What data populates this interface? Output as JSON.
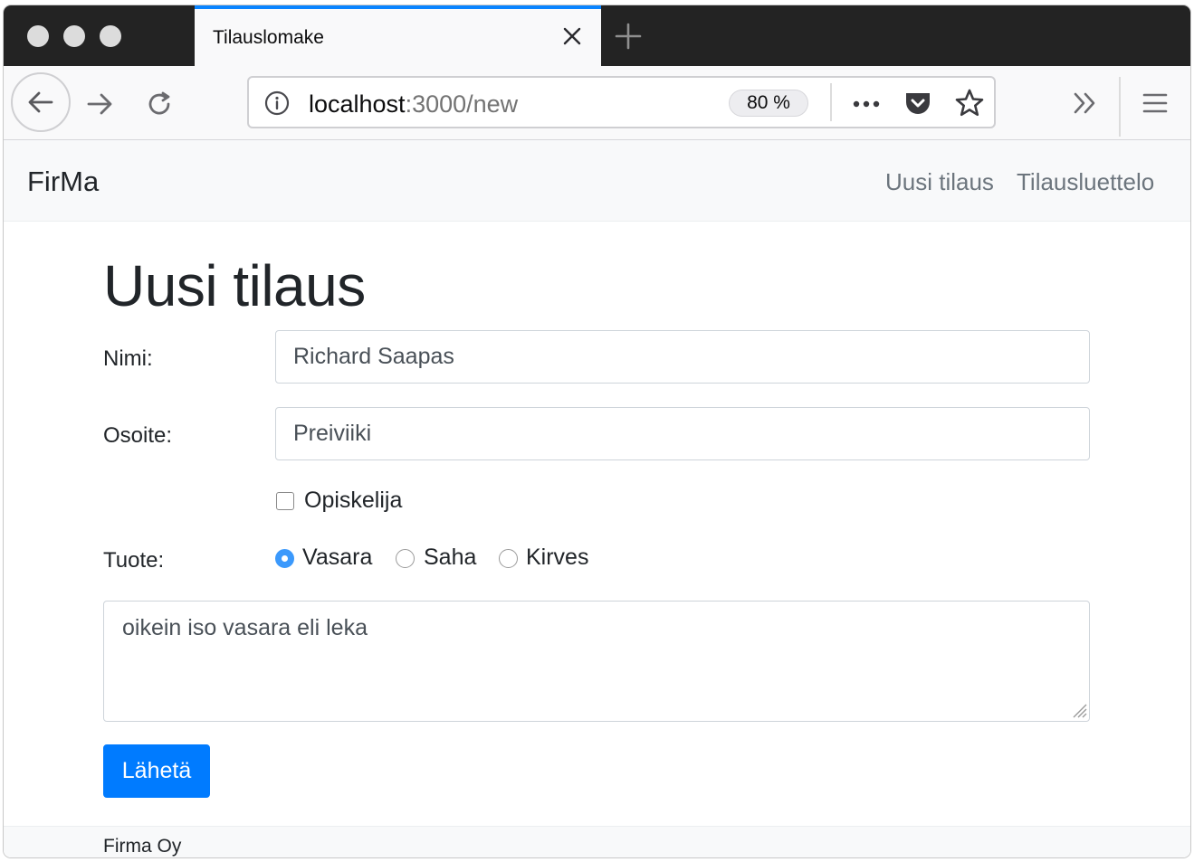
{
  "browser": {
    "tab_title": "Tilauslomake",
    "url_host": "localhost",
    "url_path": ":3000/new",
    "zoom": "80 %",
    "accent_color": "#0a84ff",
    "icons": [
      "back-arrow-icon",
      "forward-arrow-icon",
      "reload-icon",
      "info-icon",
      "more-icon",
      "pocket-icon",
      "bookmark-star-icon",
      "overflow-chevrons-icon",
      "hamburger-menu-icon",
      "close-icon",
      "plus-icon"
    ]
  },
  "site_nav": {
    "brand": "FirMa",
    "links": [
      "Uusi tilaus",
      "Tilausluettelo"
    ]
  },
  "form": {
    "heading": "Uusi tilaus",
    "name_label": "Nimi:",
    "name_value": "Richard Saapas",
    "address_label": "Osoite:",
    "address_value": "Preiviiki",
    "student_label": "Opiskelija",
    "student_checked": false,
    "product_label": "Tuote:",
    "products": [
      "Vasara",
      "Saha",
      "Kirves"
    ],
    "selected_product": "Vasara",
    "notes_value": "oikein iso vasara eli leka",
    "submit_label": "Lähetä",
    "primary_color": "#007bff"
  },
  "footer": {
    "text": "Firma Oy"
  }
}
